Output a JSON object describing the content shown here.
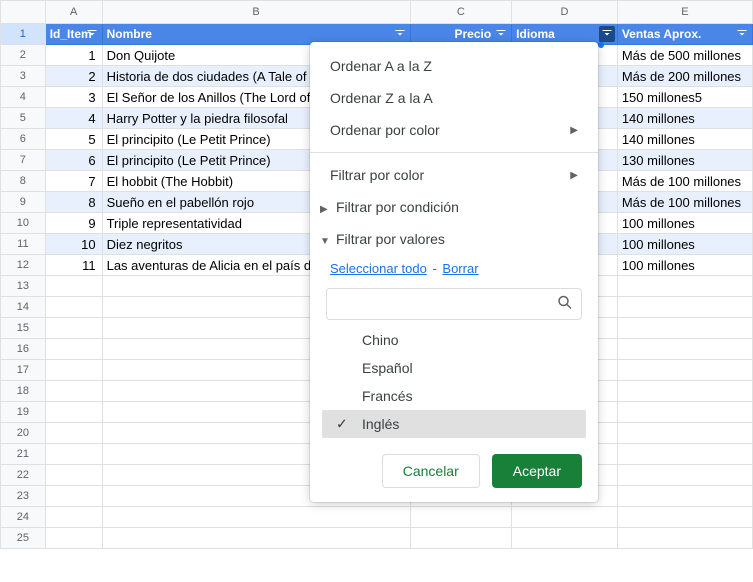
{
  "columns": {
    "A": "A",
    "B": "B",
    "C": "C",
    "D": "D",
    "E": "E"
  },
  "headers": {
    "id": "Id_Item",
    "nombre": "Nombre",
    "precio": "Precio",
    "idioma": "Idioma",
    "ventas": "Ventas Aprox."
  },
  "rows": [
    {
      "id": "1",
      "nombre": "Don Quijote",
      "ventas": "Más de 500 millones"
    },
    {
      "id": "2",
      "nombre": "Historia de dos ciudades (A Tale of Two Cities)",
      "ventas": "Más de 200 millones"
    },
    {
      "id": "3",
      "nombre": "El Señor de los Anillos (The Lord of the Rings)",
      "ventas": "150 millones5"
    },
    {
      "id": "4",
      "nombre": "Harry Potter y la piedra filosofal",
      "ventas": "140 millones"
    },
    {
      "id": "5",
      "nombre": "El principito (Le Petit Prince)",
      "ventas": "140 millones"
    },
    {
      "id": "6",
      "nombre": "El principito (Le Petit Prince)",
      "ventas": "130 millones"
    },
    {
      "id": "7",
      "nombre": "El hobbit (The Hobbit)",
      "ventas": "Más de 100 millones"
    },
    {
      "id": "8",
      "nombre": "Sueño en el pabellón rojo",
      "ventas": "Más de 100 millones"
    },
    {
      "id": "9",
      "nombre": "Triple representatividad",
      "ventas": "100 millones"
    },
    {
      "id": "10",
      "nombre": "Diez negritos",
      "ventas": "100 millones"
    },
    {
      "id": "11",
      "nombre": "Las aventuras de Alicia en el país de las maravillas",
      "ventas": "100 millones"
    }
  ],
  "row_numbers": [
    "1",
    "2",
    "3",
    "4",
    "5",
    "6",
    "7",
    "8",
    "9",
    "10",
    "11",
    "12",
    "13",
    "14",
    "15",
    "16",
    "17",
    "18",
    "19",
    "20",
    "21",
    "22",
    "23",
    "24",
    "25"
  ],
  "popup": {
    "sort_az": "Ordenar A a la Z",
    "sort_za": "Ordenar Z a la A",
    "sort_color": "Ordenar por color",
    "filter_color": "Filtrar por color",
    "filter_condition": "Filtrar por condición",
    "filter_values": "Filtrar por valores",
    "select_all": "Seleccionar todo",
    "clear": "Borrar",
    "values": [
      {
        "label": "Chino",
        "checked": false
      },
      {
        "label": "Español",
        "checked": false
      },
      {
        "label": "Francés",
        "checked": false
      },
      {
        "label": "Inglés",
        "checked": true
      }
    ],
    "cancel": "Cancelar",
    "ok": "Aceptar",
    "search_placeholder": ""
  }
}
